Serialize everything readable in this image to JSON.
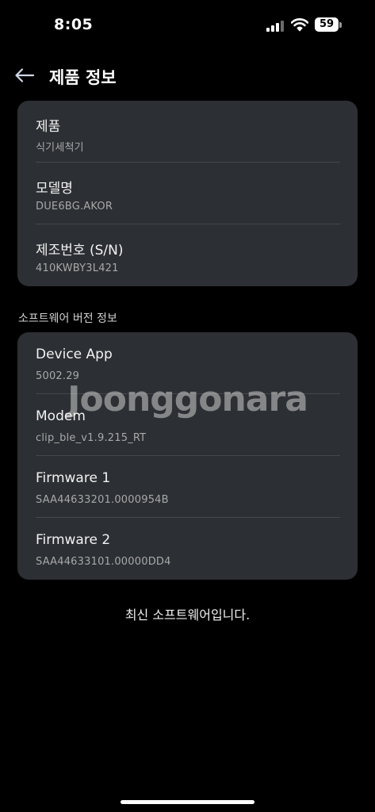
{
  "status_bar": {
    "time": "8:05",
    "battery": "59",
    "icons": [
      "signal-icon",
      "wifi-icon",
      "battery-icon"
    ]
  },
  "header": {
    "title": "제품 정보",
    "back_icon": "arrow-left-icon"
  },
  "product_info": [
    {
      "label": "제품",
      "value": "식기세척기"
    },
    {
      "label": "모델명",
      "value": "DUE6BG.AKOR"
    },
    {
      "label": "제조번호 (S/N)",
      "value": "410KWBY3L421"
    }
  ],
  "software_section": {
    "title": "소프트웨어 버전 정보",
    "items": [
      {
        "label": "Device App",
        "value": "5002.29"
      },
      {
        "label": "Modem",
        "value": "clip_ble_v1.9.215_RT"
      },
      {
        "label": "Firmware 1",
        "value": "SAA44633201.0000954B"
      },
      {
        "label": "Firmware 2",
        "value": "SAA44633101.00000DD4"
      }
    ]
  },
  "watermark": "Joonggonara",
  "footer_status": "최신 소프트웨어입니다.",
  "colors": {
    "background": "#000000",
    "card": "#2c2f33",
    "divider": "#44474b",
    "secondary_text": "#a8a8a8"
  }
}
